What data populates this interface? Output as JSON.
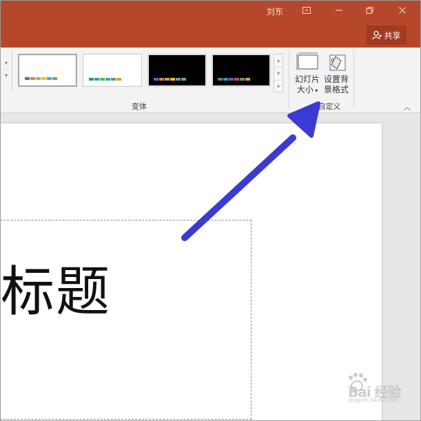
{
  "titlebar": {
    "user_name": "刘东",
    "buttons": [
      "ribbon-display-icon",
      "minimize-icon",
      "restore-icon",
      "close-icon"
    ],
    "share_label": "共享",
    "bg_color": "#b7472a"
  },
  "ribbon": {
    "variants": {
      "label": "变体",
      "items": [
        {
          "bg": "#ffffff",
          "selected": true,
          "bars": [
            "#4472c4",
            "#ed7d31",
            "#a5a5a5",
            "#ffc000",
            "#5b9bd5",
            "#70ad47"
          ]
        },
        {
          "bg": "#ffffff",
          "selected": false,
          "bars": [
            "#3e8e6a",
            "#2e9bb5",
            "#6ab04c",
            "#3aa0c8",
            "#46a17a",
            "#e59b2e"
          ]
        },
        {
          "bg": "#000000",
          "selected": false,
          "bars": [
            "#4472c4",
            "#ed7d31",
            "#a5a5a5",
            "#ffc000",
            "#5b9bd5",
            "#70ad47"
          ]
        },
        {
          "bg": "#000000",
          "selected": false,
          "bars": [
            "#3e8e6a",
            "#2e9bb5",
            "#6a5acd",
            "#c0504d",
            "#46a17a",
            "#e59b2e"
          ]
        }
      ]
    },
    "customize": {
      "label": "自定义",
      "slide_size_line1": "幻灯片",
      "slide_size_line2": "大小",
      "format_bg_line1": "设置背",
      "format_bg_line2": "景格式"
    }
  },
  "slide": {
    "title_text": "标题"
  },
  "annotation": {
    "arrow_color": "#3b3bd4"
  },
  "watermark": {
    "text": "Bai 经验",
    "sub": "jingyan.baidu.com"
  }
}
